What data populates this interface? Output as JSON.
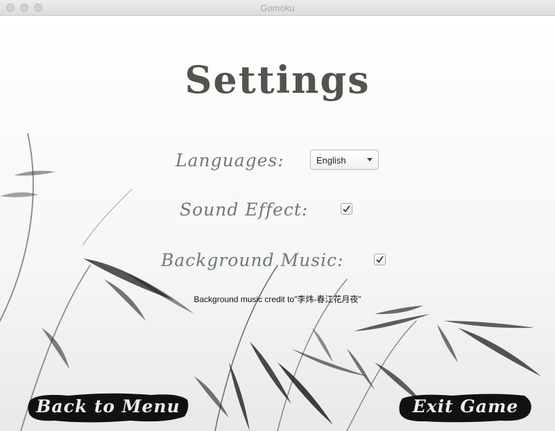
{
  "window": {
    "title": "Gomoku"
  },
  "settings": {
    "heading": "Settings",
    "languages_label": "Languages:",
    "language_selected": "English",
    "sound_effect_label": "Sound Effect:",
    "sound_effect_enabled": true,
    "background_music_label": "Background Music:",
    "background_music_enabled": true,
    "credit_text": "Background music credit to\"李炜-春江花月夜\""
  },
  "buttons": {
    "back_label": "Back to Menu",
    "exit_label": "Exit Game"
  },
  "colors": {
    "heading": "#50554d",
    "label": "#6d7a72",
    "ink_button": "#111111",
    "ink_text": "#e9efe9"
  },
  "icons": {
    "check": "check-icon",
    "dropdown": "chevron-down-icon"
  }
}
